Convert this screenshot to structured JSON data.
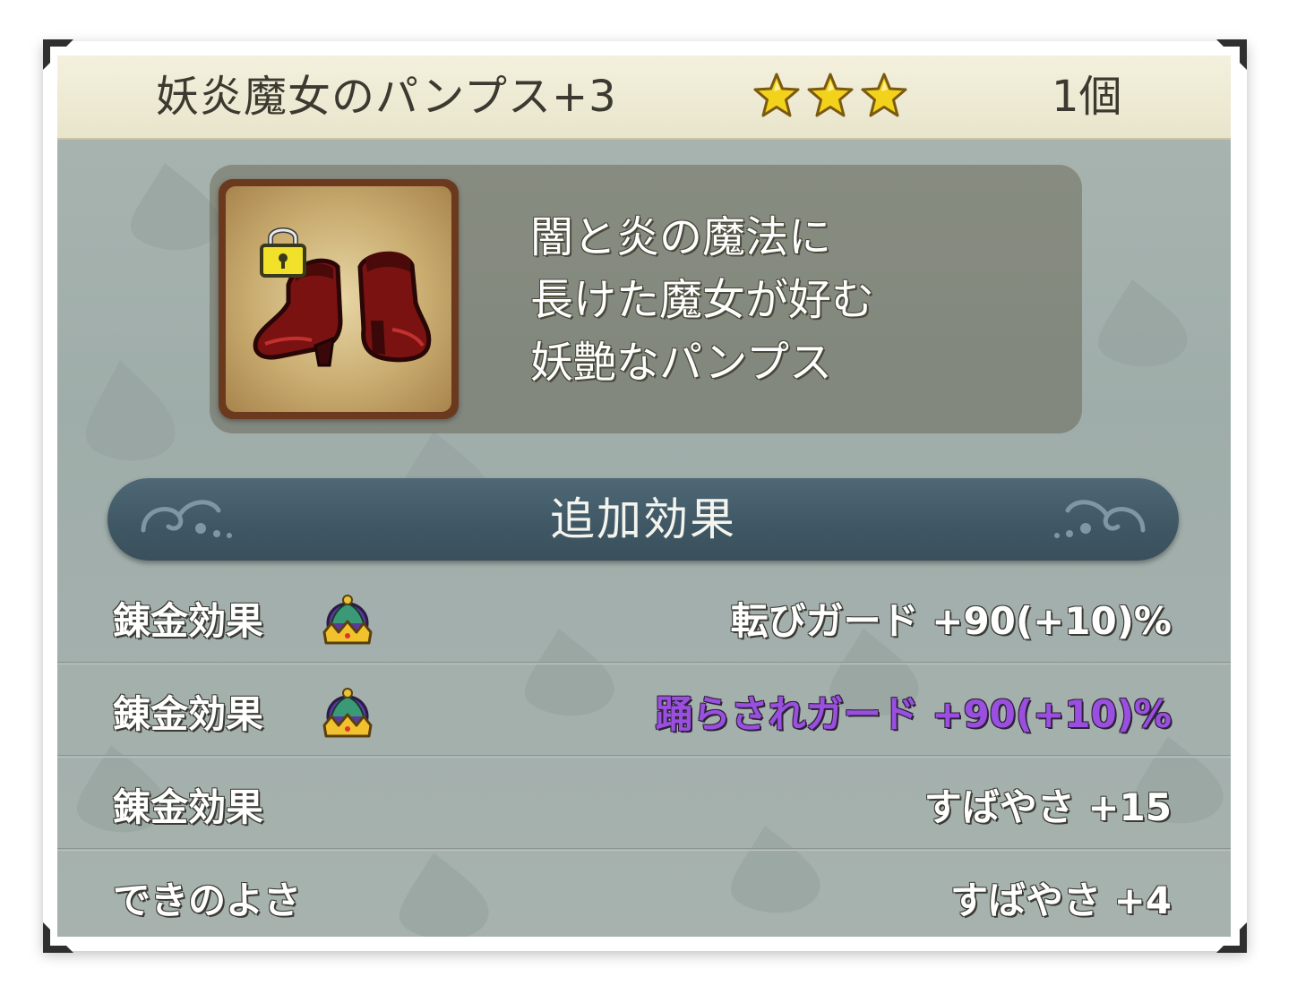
{
  "item": {
    "name": "妖炎魔女のパンプス+3",
    "stars": 3,
    "quantity": "1個",
    "locked": true,
    "icon": "red-pumps-icon"
  },
  "description": {
    "lines": [
      "闇と炎の魔法に",
      "長けた魔女が好む",
      "妖艶なパンプス"
    ]
  },
  "section": {
    "title": "追加効果"
  },
  "effects": [
    {
      "label": "錬金効果",
      "icon": "crown-icon",
      "value": "転びガード +90(+10)%",
      "highlight": false
    },
    {
      "label": "錬金効果",
      "icon": "crown-icon",
      "value": "踊らされガード +90(+10)%",
      "highlight": true
    },
    {
      "label": "錬金効果",
      "icon": "",
      "value": "すばやさ +15",
      "highlight": false
    },
    {
      "label": "できのよさ",
      "icon": "",
      "value": "すばやさ +4",
      "highlight": false
    }
  ],
  "colors": {
    "highlight_text": "#9a4fe0",
    "star": "#f3d21c",
    "header_band": "#3f5764"
  }
}
